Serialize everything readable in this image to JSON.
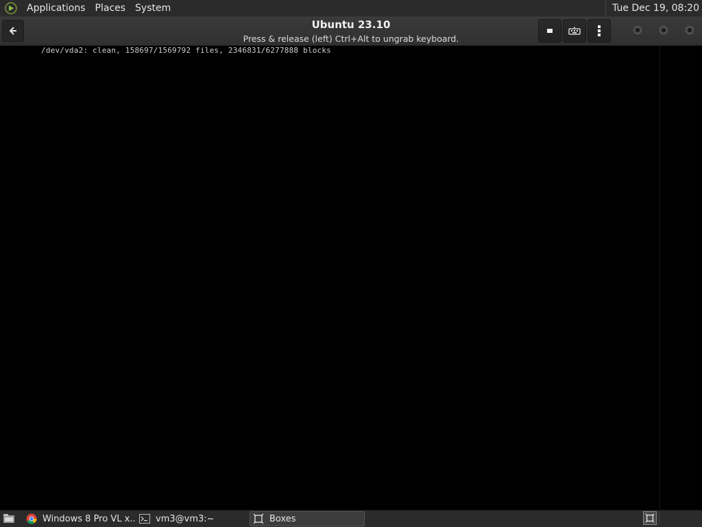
{
  "top_panel": {
    "menus": [
      "Applications",
      "Places",
      "System"
    ],
    "clock": "Tue Dec 19, 08:20"
  },
  "headerbar": {
    "title": "Ubuntu 23.10",
    "subtitle": "Press & release (left) Ctrl+Alt to ungrab keyboard."
  },
  "console": {
    "line": "/dev/vda2: clean, 158697/1569792 files, 2346831/6277888 blocks"
  },
  "taskbar": {
    "tasks": [
      {
        "label": "Windows 8 Pro VL x...",
        "icon": "chrome-icon",
        "active": false
      },
      {
        "label": "vm3@vm3:~",
        "icon": "terminal-icon",
        "active": false
      },
      {
        "label": "Boxes",
        "icon": "boxes-icon",
        "active": true
      }
    ]
  },
  "colors": {
    "panel_bg": "#2b2b2b",
    "headerbar_bg": "#353535",
    "vm_bg": "#000000",
    "mate_green": "#8bc34a"
  }
}
